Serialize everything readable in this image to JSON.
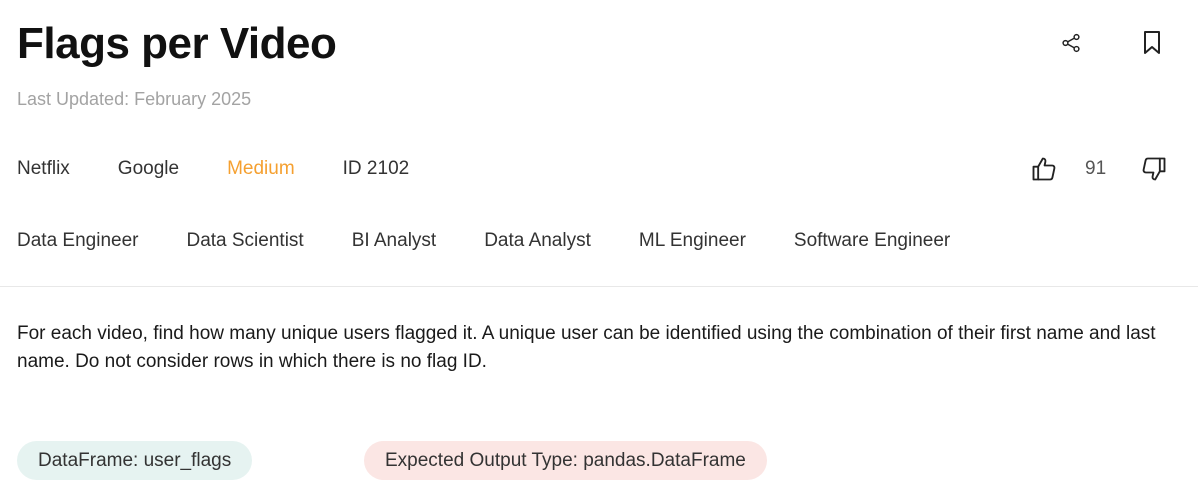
{
  "header": {
    "title": "Flags per Video",
    "last_updated": "Last Updated: February 2025"
  },
  "tags": {
    "company_1": "Netflix",
    "company_2": "Google",
    "difficulty": "Medium",
    "id": "ID 2102"
  },
  "votes": {
    "count": "91"
  },
  "roles": [
    "Data Engineer",
    "Data Scientist",
    "BI Analyst",
    "Data Analyst",
    "ML Engineer",
    "Software Engineer"
  ],
  "description": "For each video, find how many unique users flagged it. A unique user can be identified using the combination of their first name and last name. Do not consider rows in which there is no flag ID.",
  "pills": {
    "dataframe": "DataFrame: user_flags",
    "expected_output": "Expected Output Type: pandas.DataFrame"
  },
  "colors": {
    "difficulty_medium": "#f5a030",
    "dataframe_pill_bg": "#e6f3f1",
    "output_pill_bg": "#fbe6e4",
    "muted_text": "#a3a3a3"
  },
  "icons": {
    "share": "share-icon",
    "bookmark": "bookmark-icon",
    "like": "thumbs-up-icon",
    "dislike": "thumbs-down-icon"
  }
}
